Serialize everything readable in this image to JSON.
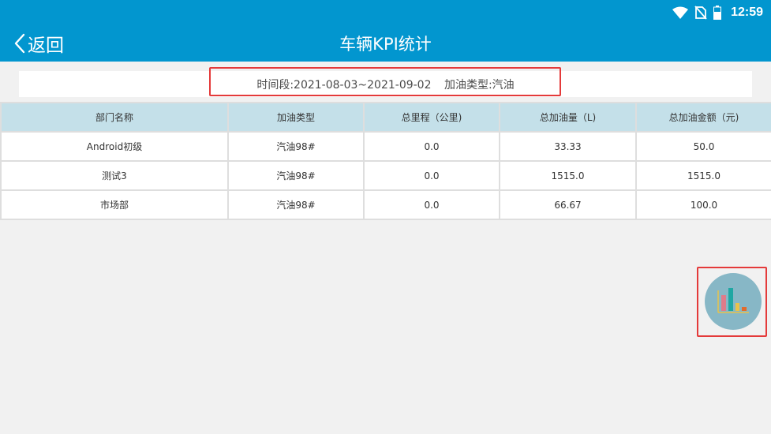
{
  "status_bar": {
    "time": "12:59",
    "icons": [
      "wifi-icon",
      "no-sim-icon",
      "battery-icon"
    ]
  },
  "app_bar": {
    "back_label": "返回",
    "title": "车辆KPI统计"
  },
  "filter": {
    "period": "时间段:2021-08-03~2021-09-02",
    "fuel_type": "加油类型:汽油"
  },
  "table": {
    "columns": [
      "部门名称",
      "加油类型",
      "总里程（公里)",
      "总加油量（L)",
      "总加油金额（元)"
    ],
    "rows": [
      [
        "Android初级",
        "汽油98#",
        "0.0",
        "33.33",
        "50.0"
      ],
      [
        "测试3",
        "汽油98#",
        "0.0",
        "1515.0",
        "1515.0"
      ],
      [
        "市场部",
        "汽油98#",
        "0.0",
        "66.67",
        "100.0"
      ]
    ]
  },
  "fab": {
    "icon": "bar-chart-icon"
  },
  "colors": {
    "primary": "#0296cf",
    "header_row": "#c4e0e9",
    "highlight": "#e43a3a",
    "fab_bg": "#87b7c6"
  }
}
